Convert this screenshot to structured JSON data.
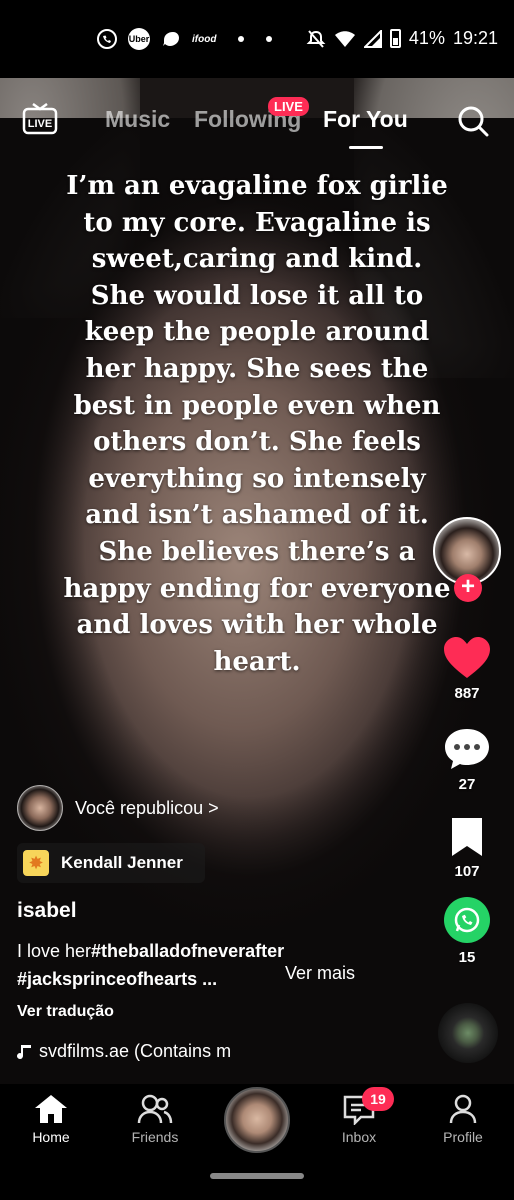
{
  "status_bar": {
    "time": "19:21",
    "battery": "41%",
    "apps": [
      "whatsapp-icon",
      "uber-icon",
      "messenger-icon",
      "ifood-icon"
    ],
    "uber_label": "Uber",
    "ifood_label": "ifood"
  },
  "top_nav": {
    "live_icon_label": "LIVE",
    "tabs": [
      {
        "label": "Music",
        "active": false
      },
      {
        "label": "Following",
        "active": false
      },
      {
        "label": "For You",
        "active": true
      }
    ],
    "following_badge": "LIVE"
  },
  "video": {
    "overlay_text": "I’m an evagaline fox girlie to my core. Evagaline is sweet,caring and kind. She would lose it all to keep the people around her happy. She sees the best in people even when others don’t. She feels everything so intensely and isn’t ashamed of it. She believes there’s a happy ending for everyone and loves with her whole heart."
  },
  "rail": {
    "likes": "887",
    "comments": "27",
    "saves": "107",
    "shares": "15",
    "accent": "#fe2c55",
    "share_color": "#25d366"
  },
  "post": {
    "repost_text": "Você republicou >",
    "tagged_label": "Kendall Jenner",
    "username": "isabel",
    "caption_prefix": "I love her",
    "hashtag1": "#theballadofneverafter",
    "hashtag2": "#jacksprinceofhearts ...",
    "see_more": "Ver mais",
    "translate": "Ver tradução",
    "sound": "svdfilms.ae (Contains m"
  },
  "bottom_nav": {
    "items": [
      {
        "label": "Home",
        "active": true
      },
      {
        "label": "Friends",
        "active": false
      },
      {
        "label": "Inbox",
        "active": false
      },
      {
        "label": "Profile",
        "active": false
      }
    ],
    "inbox_badge": "19"
  }
}
